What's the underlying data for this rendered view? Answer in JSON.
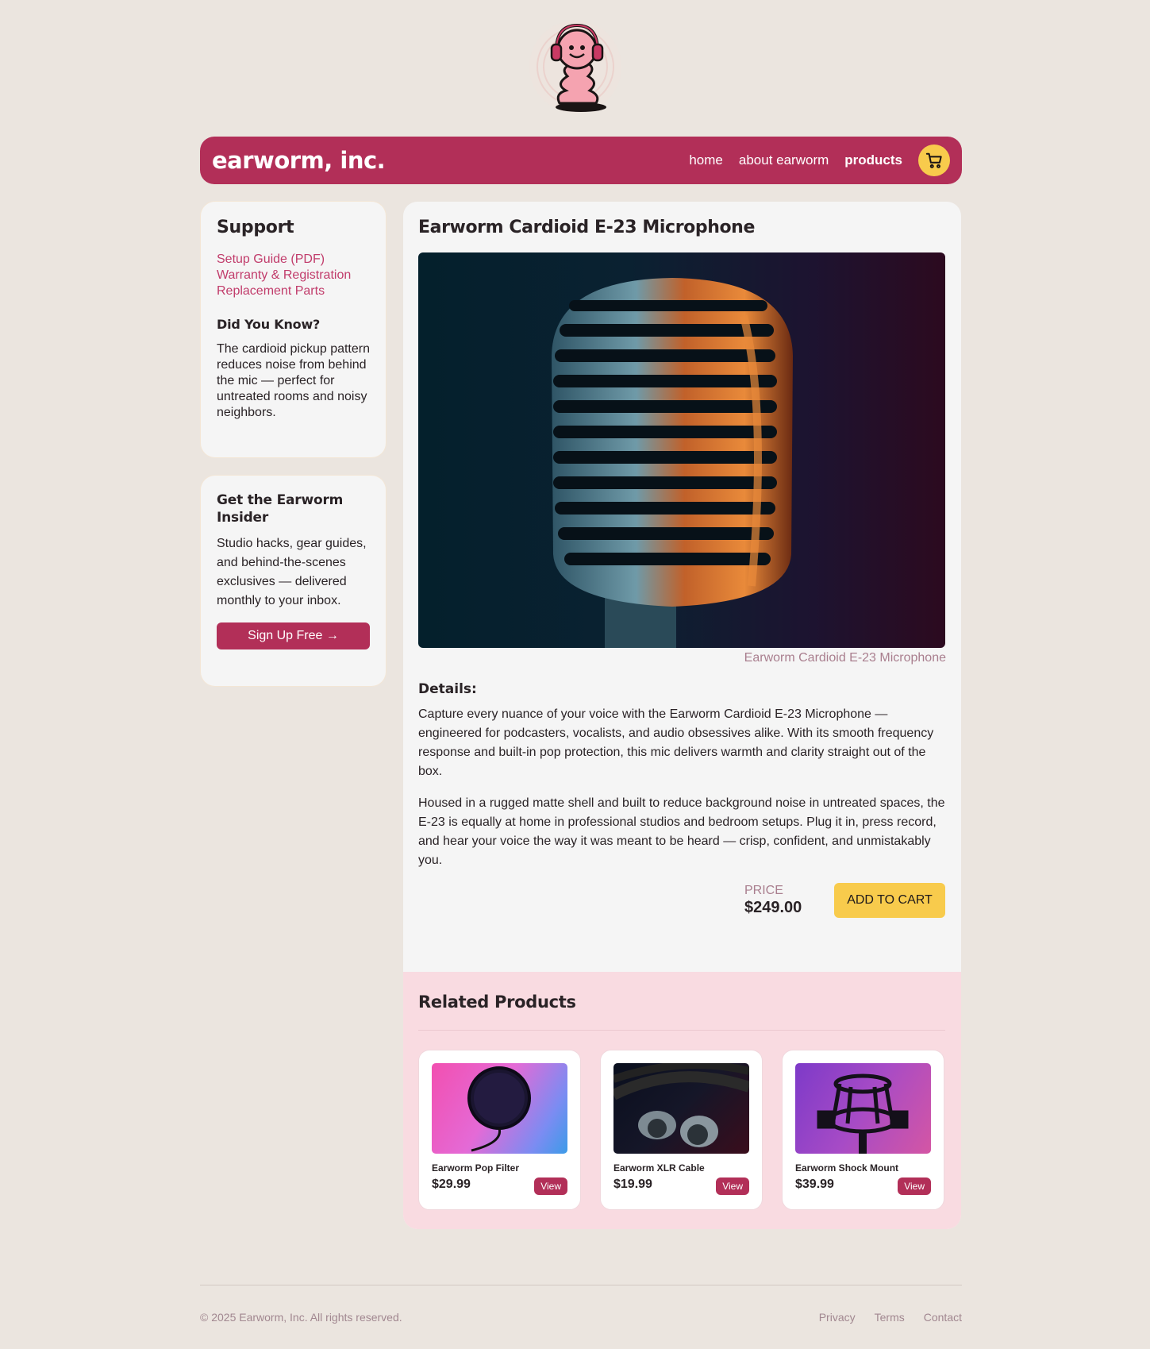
{
  "header": {
    "brand": "earworm, inc.",
    "nav": [
      {
        "label": "home"
      },
      {
        "label": "about earworm"
      },
      {
        "label": "products"
      }
    ],
    "cart_icon": "cart-icon"
  },
  "sidebar": {
    "support": {
      "title": "Support",
      "links": [
        "Setup Guide (PDF)",
        "Warranty & Registration",
        "Replacement Parts"
      ],
      "did_you_know_title": "Did You Know?",
      "did_you_know_text": "The cardioid pickup pattern reduces noise from behind the mic — perfect for untreated rooms and noisy neighbors."
    },
    "insider": {
      "title": "Get the Earworm Insider",
      "text": "Studio hacks, gear guides, and behind-the-scenes exclusives — delivered monthly to your inbox.",
      "button": "Sign Up Free →"
    }
  },
  "product": {
    "title": "Earworm Cardioid E-23 Microphone",
    "caption": "Earworm Cardioid E-23 Microphone",
    "details_heading": "Details:",
    "paragraph1": "Capture every nuance of your voice with the Earworm Cardioid E-23 Microphone — engineered for podcasters, vocalists, and audio obsessives alike. With its smooth frequency response and built-in pop protection, this mic delivers warmth and clarity straight out of the box.",
    "paragraph2": "Housed in a rugged matte shell and built to reduce background noise in untreated spaces, the E-23 is equally at home in professional studios and bedroom setups. Plug it in, press record, and hear your voice the way it was meant to be heard — crisp, confident, and unmistakably you.",
    "price_label": "PRICE",
    "price": "$249.00",
    "add_to_cart": "ADD TO CART"
  },
  "related": {
    "title": "Related Products",
    "items": [
      {
        "name": "Earworm Pop Filter",
        "price": "$29.99",
        "button": "View"
      },
      {
        "name": "Earworm XLR Cable",
        "price": "$19.99",
        "button": "View"
      },
      {
        "name": "Earworm Shock Mount",
        "price": "$39.99",
        "button": "View"
      }
    ]
  },
  "footer": {
    "copyright": "© 2025 Earworm, Inc. All rights reserved.",
    "links": [
      "Privacy",
      "Terms",
      "Contact"
    ]
  },
  "colors": {
    "brand": "#b22f58",
    "accent": "#f8cb4c",
    "background": "#ebe5df",
    "related_bg": "#f9dbe1"
  }
}
